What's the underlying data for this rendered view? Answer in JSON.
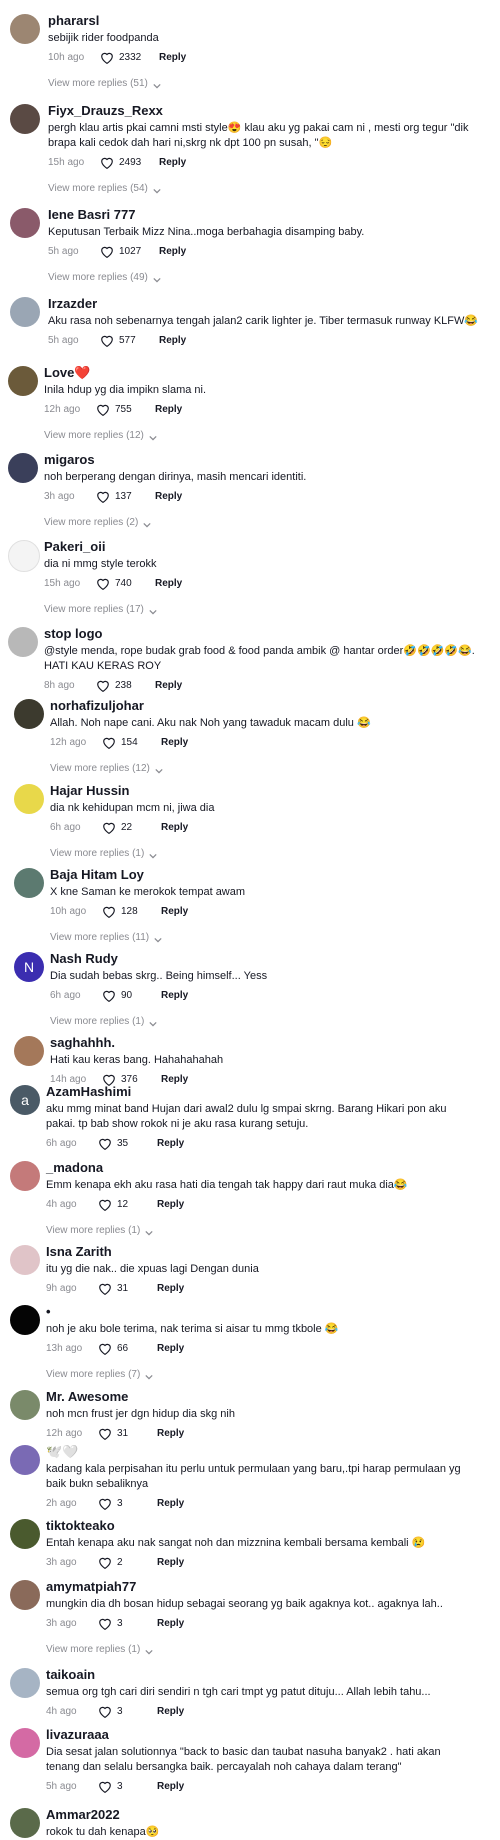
{
  "comments": [
    {
      "user": "phararsl",
      "text": "sebijik rider foodpanda",
      "time": "10h ago",
      "likes": "2332",
      "reply": "Reply",
      "more": "View more replies (51)",
      "avatar_color": "#9c8672",
      "avatar_letter": ""
    },
    {
      "user": "Fiyx_Drauzs_Rexx",
      "text": "pergh klau artis pkai camni msti style😍 klau aku yg pakai cam ni , mesti org tegur \"dik brapa kali cedok dah hari ni,skrg nk dpt 100 pn susah, \"😔",
      "time": "15h ago",
      "likes": "2493",
      "reply": "Reply",
      "more": "View more replies (54)",
      "avatar_color": "#5a4a44",
      "avatar_letter": ""
    },
    {
      "user": "Iene Basri 777",
      "text": "Keputusan Terbaik Mizz Nina..moga berbahagia disamping baby.",
      "time": "5h ago",
      "likes": "1027",
      "reply": "Reply",
      "more": "View more replies (49)",
      "avatar_color": "#8a5a6a",
      "avatar_letter": ""
    },
    {
      "user": "Irzazder",
      "text": "Aku rasa noh sebenarnya tengah jalan2 carik lighter je. Tiber termasuk runway KLFW😂",
      "time": "5h ago",
      "likes": "577",
      "reply": "Reply",
      "more": "",
      "avatar_color": "#9aa6b4",
      "avatar_letter": ""
    },
    {
      "user": "Love❤️",
      "text": "Inila hdup yg dia impikn slama ni.",
      "time": "12h ago",
      "likes": "755",
      "reply": "Reply",
      "more": "View more replies (12)",
      "avatar_color": "#6b5a3a",
      "avatar_letter": ""
    },
    {
      "user": "migaros",
      "text": "noh berperang dengan dirinya, masih mencari identiti.",
      "time": "3h ago",
      "likes": "137",
      "reply": "Reply",
      "more": "View more replies (2)",
      "avatar_color": "#3a3f5a",
      "avatar_letter": ""
    },
    {
      "user": "Pakeri_oii",
      "text": "dia ni mmg style terokk",
      "time": "15h ago",
      "likes": "740",
      "reply": "Reply",
      "more": "View more replies (17)",
      "avatar_color": "#f4f4f4",
      "avatar_letter": ""
    },
    {
      "user": "stop logo",
      "text": "@style menda, rope budak grab food & food panda ambik @ hantar order🤣🤣🤣🤣😂. HATI KAU KERAS ROY",
      "time": "8h ago",
      "likes": "238",
      "reply": "Reply",
      "more": "",
      "avatar_color": "#b8b8b8",
      "avatar_letter": ""
    },
    {
      "user": "norhafizuljohar",
      "text": "Allah. Noh nape cani. Aku nak Noh yang tawaduk macam dulu 😂",
      "time": "12h ago",
      "likes": "154",
      "reply": "Reply",
      "more": "View more replies (12)",
      "avatar_color": "#3c3a2e",
      "avatar_letter": ""
    },
    {
      "user": "Hajar Hussin",
      "text": "dia nk kehidupan mcm ni, jiwa dia",
      "time": "6h ago",
      "likes": "22",
      "reply": "Reply",
      "more": "View more replies (1)",
      "avatar_color": "#e8d84a",
      "avatar_letter": ""
    },
    {
      "user": "Baja Hitam Loy",
      "text": "X kne Saman ke merokok tempat awam",
      "time": "10h ago",
      "likes": "128",
      "reply": "Reply",
      "more": "View more replies (11)",
      "avatar_color": "#5c7a70",
      "avatar_letter": ""
    },
    {
      "user": "Nash Rudy",
      "text": "Dia sudah bebas skrg.. Being himself... Yess",
      "time": "6h ago",
      "likes": "90",
      "reply": "Reply",
      "more": "View more replies (1)",
      "avatar_color": "#3b2db0",
      "avatar_letter": "N"
    },
    {
      "user": "saghahhh.",
      "text": "Hati kau keras bang. Hahahahahah",
      "time": "14h ago",
      "likes": "376",
      "reply": "Reply",
      "more": "",
      "avatar_color": "#a4785a",
      "avatar_letter": ""
    },
    {
      "user": "AzamHashimi",
      "text": "aku mmg minat band Hujan dari awal2 dulu lg smpai skrng. Barang Hikari pon aku pakai. tp bab show rokok ni je aku rasa kurang setuju.",
      "time": "6h ago",
      "likes": "35",
      "reply": "Reply",
      "more": "",
      "avatar_color": "#4a5a66",
      "avatar_letter": "a"
    },
    {
      "user": "_madona",
      "text": "Emm kenapa ekh aku rasa hati dia tengah tak happy dari raut muka dia😂",
      "time": "4h ago",
      "likes": "12",
      "reply": "Reply",
      "more": "View more replies (1)",
      "avatar_color": "#c47a7a",
      "avatar_letter": ""
    },
    {
      "user": "Isna Zarith",
      "text": "itu yg die nak.. die xpuas lagi Dengan dunia",
      "time": "9h ago",
      "likes": "31",
      "reply": "Reply",
      "more": "",
      "avatar_color": "#e0c4c8",
      "avatar_letter": ""
    },
    {
      "user": "•",
      "text": "noh je aku bole terima, nak terima si aisar tu mmg tkbole 😂",
      "time": "13h ago",
      "likes": "66",
      "reply": "Reply",
      "more": "View more replies (7)",
      "avatar_color": "#050505",
      "avatar_letter": ""
    },
    {
      "user": "Mr. Awesome",
      "text": "noh mcn frust jer dgn hidup dia skg nih",
      "time": "12h ago",
      "likes": "31",
      "reply": "Reply",
      "more": "",
      "avatar_color": "#7a8a6a",
      "avatar_letter": ""
    },
    {
      "user": "🕊️🤍",
      "text": "kadang kala perpisahan itu perlu untuk permulaan yang baru,.tpi harap permulaan yg baik bukn sebaliknya",
      "time": "2h ago",
      "likes": "3",
      "reply": "Reply",
      "more": "",
      "avatar_color": "#7a6ab4",
      "avatar_letter": ""
    },
    {
      "user": "tiktokteako",
      "text": "Entah kenapa aku nak sangat noh dan mizznina kembali bersama kembali 😢",
      "time": "3h ago",
      "likes": "2",
      "reply": "Reply",
      "more": "",
      "avatar_color": "#4a5a2e",
      "avatar_letter": ""
    },
    {
      "user": "amymatpiah77",
      "text": "mungkin dia dh bosan hidup sebagai seorang yg baik agaknya kot.. agaknya lah..",
      "time": "3h ago",
      "likes": "3",
      "reply": "Reply",
      "more": "View more replies (1)",
      "avatar_color": "#8a6a5a",
      "avatar_letter": ""
    },
    {
      "user": "taikoain",
      "text": "semua org tgh cari diri sendiri n tgh cari tmpt yg patut dituju... Allah lebih tahu...",
      "time": "4h ago",
      "likes": "3",
      "reply": "Reply",
      "more": "",
      "avatar_color": "#a6b4c4",
      "avatar_letter": ""
    },
    {
      "user": "livazuraaa",
      "text": "Dia sesat jalan solutionnya \"back to basic dan taubat nasuha banyak2 . hati akan tenang dan selalu bersangka baik. percayalah noh cahaya dalam terang\"",
      "time": "5h ago",
      "likes": "3",
      "reply": "Reply",
      "more": "",
      "avatar_color": "#d46aa4",
      "avatar_letter": ""
    },
    {
      "user": "Ammar2022",
      "text": "rokok tu dah kenapa🥺",
      "time": "",
      "likes": "",
      "reply": "",
      "more": "",
      "avatar_color": "#5a6a4a",
      "avatar_letter": ""
    }
  ]
}
